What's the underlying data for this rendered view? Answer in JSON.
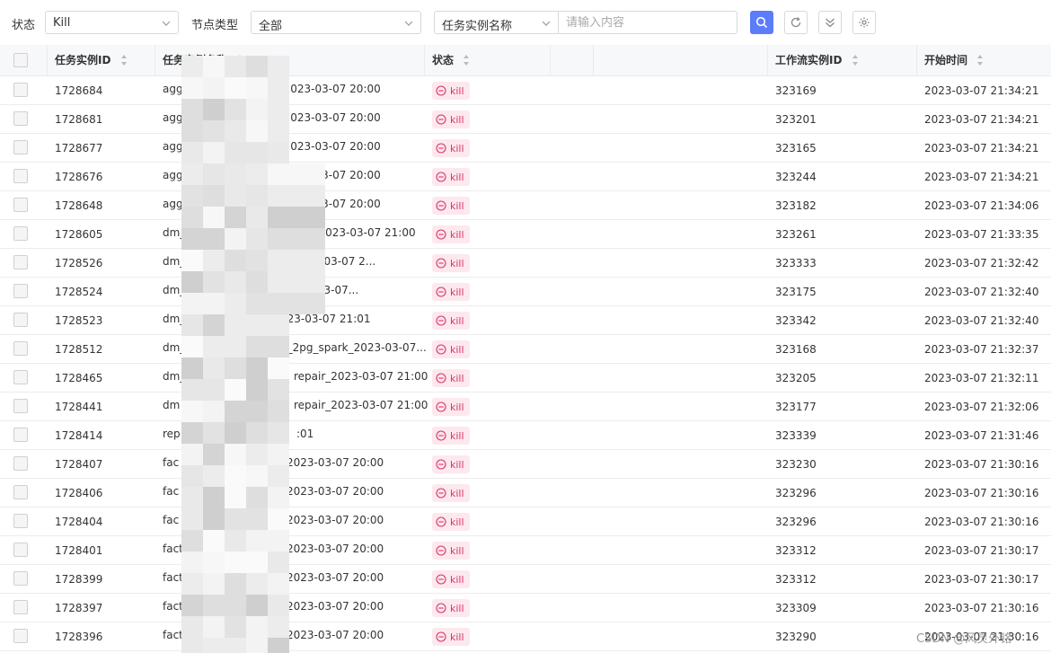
{
  "filters": {
    "status_label": "状态",
    "status_value": "Kill",
    "node_type_label": "节点类型",
    "node_type_value": "全部",
    "search_field_value": "任务实例名称",
    "search_placeholder": "请输入内容"
  },
  "toolbar_icons": [
    "search-icon",
    "refresh-icon",
    "collapse-icon",
    "settings-icon"
  ],
  "table": {
    "headers": {
      "id": "任务实例ID",
      "name": "任务实例名称",
      "status": "状态",
      "workflow_id": "工作流实例ID",
      "start_time": "开始时间"
    },
    "rows": [
      {
        "id": "1728684",
        "name": "aggr_",
        "name_tail": "h_2023-03-07 20:00",
        "status": "kill",
        "workflow_id": "323169",
        "start_time": "2023-03-07 21:34:21"
      },
      {
        "id": "1728681",
        "name": "aggr_",
        "name_tail": "h_2023-03-07 20:00",
        "status": "kill",
        "workflow_id": "323201",
        "start_time": "2023-03-07 21:34:21"
      },
      {
        "id": "1728677",
        "name": "aggr_",
        "name_tail": "h_2023-03-07 20:00",
        "status": "kill",
        "workflow_id": "323165",
        "start_time": "2023-03-07 21:34:21"
      },
      {
        "id": "1728676",
        "name": "aggr_",
        "name_tail": "n_2023-03-07 20:00",
        "status": "kill",
        "workflow_id": "323244",
        "start_time": "2023-03-07 21:34:21"
      },
      {
        "id": "1728648",
        "name": "aggr_",
        "name_tail": "n_2023-03-07 20:00",
        "status": "kill",
        "workflow_id": "323182",
        "start_time": "2023-03-07 21:34:06"
      },
      {
        "id": "1728605",
        "name": "dm_c",
        "name_tail": "d_2pg_2023-03-07 21:00",
        "status": "kill",
        "workflow_id": "323261",
        "start_time": "2023-03-07 21:33:35"
      },
      {
        "id": "1728526",
        "name": "dm_l",
        "name_tail": "g_2023-03-07 2...",
        "status": "kill",
        "workflow_id": "323333",
        "start_time": "2023-03-07 21:32:42"
      },
      {
        "id": "1728524",
        "name": "dm_c",
        "name_tail": "_2023-03-07...",
        "status": "kill",
        "workflow_id": "323175",
        "start_time": "2023-03-07 21:32:40"
      },
      {
        "id": "1728523",
        "name": "dm_l",
        "name_tail": "023-03-07 21:01",
        "status": "kill",
        "workflow_id": "323342",
        "start_time": "2023-03-07 21:32:40"
      },
      {
        "id": "1728512",
        "name": "dm_",
        "name_tail": "d_2pg_spark_2023-03-07...",
        "status": "kill",
        "workflow_id": "323168",
        "start_time": "2023-03-07 21:32:37"
      },
      {
        "id": "1728465",
        "name": "dm_",
        "name_tail": "repair_2023-03-07 21:00",
        "status": "kill",
        "workflow_id": "323205",
        "start_time": "2023-03-07 21:32:11"
      },
      {
        "id": "1728441",
        "name": "dm",
        "name_tail": "repair_2023-03-07 21:00",
        "status": "kill",
        "workflow_id": "323177",
        "start_time": "2023-03-07 21:32:06"
      },
      {
        "id": "1728414",
        "name": "rep",
        "name_tail": ":01",
        "status": "kill",
        "workflow_id": "323339",
        "start_time": "2023-03-07 21:31:46"
      },
      {
        "id": "1728407",
        "name": "fac",
        "name_tail": "2023-03-07 20:00",
        "status": "kill",
        "workflow_id": "323230",
        "start_time": "2023-03-07 21:30:16"
      },
      {
        "id": "1728406",
        "name": "fac",
        "name_tail": "2023-03-07 20:00",
        "status": "kill",
        "workflow_id": "323296",
        "start_time": "2023-03-07 21:30:16"
      },
      {
        "id": "1728404",
        "name": "fac",
        "name_tail": "2023-03-07 20:00",
        "status": "kill",
        "workflow_id": "323296",
        "start_time": "2023-03-07 21:30:16"
      },
      {
        "id": "1728401",
        "name": "fact",
        "name_tail": "2023-03-07 20:00",
        "status": "kill",
        "workflow_id": "323312",
        "start_time": "2023-03-07 21:30:17"
      },
      {
        "id": "1728399",
        "name": "fact",
        "name_tail": "2023-03-07 20:00",
        "status": "kill",
        "workflow_id": "323312",
        "start_time": "2023-03-07 21:30:17"
      },
      {
        "id": "1728397",
        "name": "fact_",
        "name_tail": "2023-03-07 20:00",
        "status": "kill",
        "workflow_id": "323309",
        "start_time": "2023-03-07 21:30:16"
      },
      {
        "id": "1728396",
        "name": "fact_",
        "name_tail": "2023-03-07 20:00",
        "status": "kill",
        "workflow_id": "323290",
        "start_time": "2023-03-07 21:30:16"
      }
    ]
  },
  "watermark": "CSDN @风灵外铭",
  "colors": {
    "primary": "#5c7cfa",
    "kill_tag_bg": "#fde8ee",
    "kill_tag_text": "#d9366b",
    "header_bg": "#f7f8fa"
  }
}
